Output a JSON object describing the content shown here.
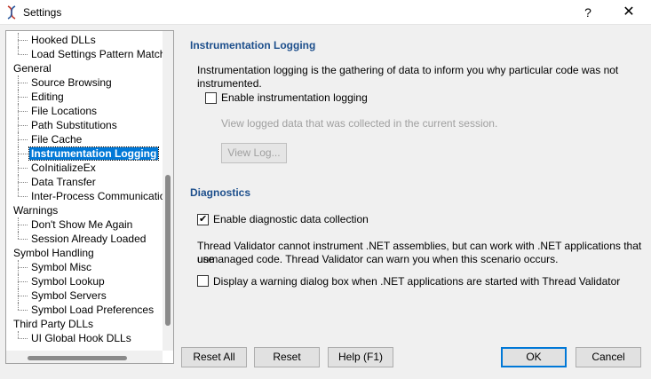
{
  "window": {
    "title": "Settings",
    "help": "?",
    "close": "✕"
  },
  "tree": {
    "items": [
      {
        "label": "Hooked DLLs",
        "level": 1
      },
      {
        "label": "Load Settings Pattern Match",
        "level": 1,
        "last": true
      },
      {
        "label": "General",
        "level": 0
      },
      {
        "label": "Source Browsing",
        "level": 1
      },
      {
        "label": "Editing",
        "level": 1
      },
      {
        "label": "File Locations",
        "level": 1
      },
      {
        "label": "Path Substitutions",
        "level": 1
      },
      {
        "label": "File Cache",
        "level": 1
      },
      {
        "label": "Instrumentation Logging",
        "level": 1,
        "selected": true
      },
      {
        "label": "CoInitializeEx",
        "level": 1
      },
      {
        "label": "Data Transfer",
        "level": 1
      },
      {
        "label": "Inter-Process Communication",
        "level": 1,
        "last": true
      },
      {
        "label": "Warnings",
        "level": 0
      },
      {
        "label": "Don't Show Me Again",
        "level": 1
      },
      {
        "label": "Session Already Loaded",
        "level": 1,
        "last": true
      },
      {
        "label": "Symbol Handling",
        "level": 0
      },
      {
        "label": "Symbol Misc",
        "level": 1
      },
      {
        "label": "Symbol Lookup",
        "level": 1
      },
      {
        "label": "Symbol Servers",
        "level": 1
      },
      {
        "label": "Symbol Load Preferences",
        "level": 1,
        "last": true
      },
      {
        "label": "Third Party DLLs",
        "level": 0
      },
      {
        "label": "UI Global Hook DLLs",
        "level": 1,
        "last": true
      }
    ]
  },
  "instrumentation": {
    "heading": "Instrumentation Logging",
    "description": "Instrumentation logging is the gathering of data to inform you why particular code was not instrumented.",
    "enable_label": "Enable instrumentation logging",
    "enable_checked": false,
    "view_hint": "View logged data that was collected in the current session.",
    "view_log_button": "View Log..."
  },
  "diagnostics": {
    "heading": "Diagnostics",
    "enable_label": "Enable diagnostic data collection",
    "enable_checked": true,
    "info_line1": "Thread Validator cannot instrument .NET assemblies, but can work with .NET applications that use",
    "info_line2": "unmanaged code. Thread Validator can warn you when this scenario occurs.",
    "warning_label": "Display a warning dialog box when .NET applications are started with Thread Validator",
    "warning_checked": false
  },
  "buttons": {
    "reset_all": "Reset All",
    "reset": "Reset",
    "help": "Help (F1)",
    "ok": "OK",
    "cancel": "Cancel"
  }
}
